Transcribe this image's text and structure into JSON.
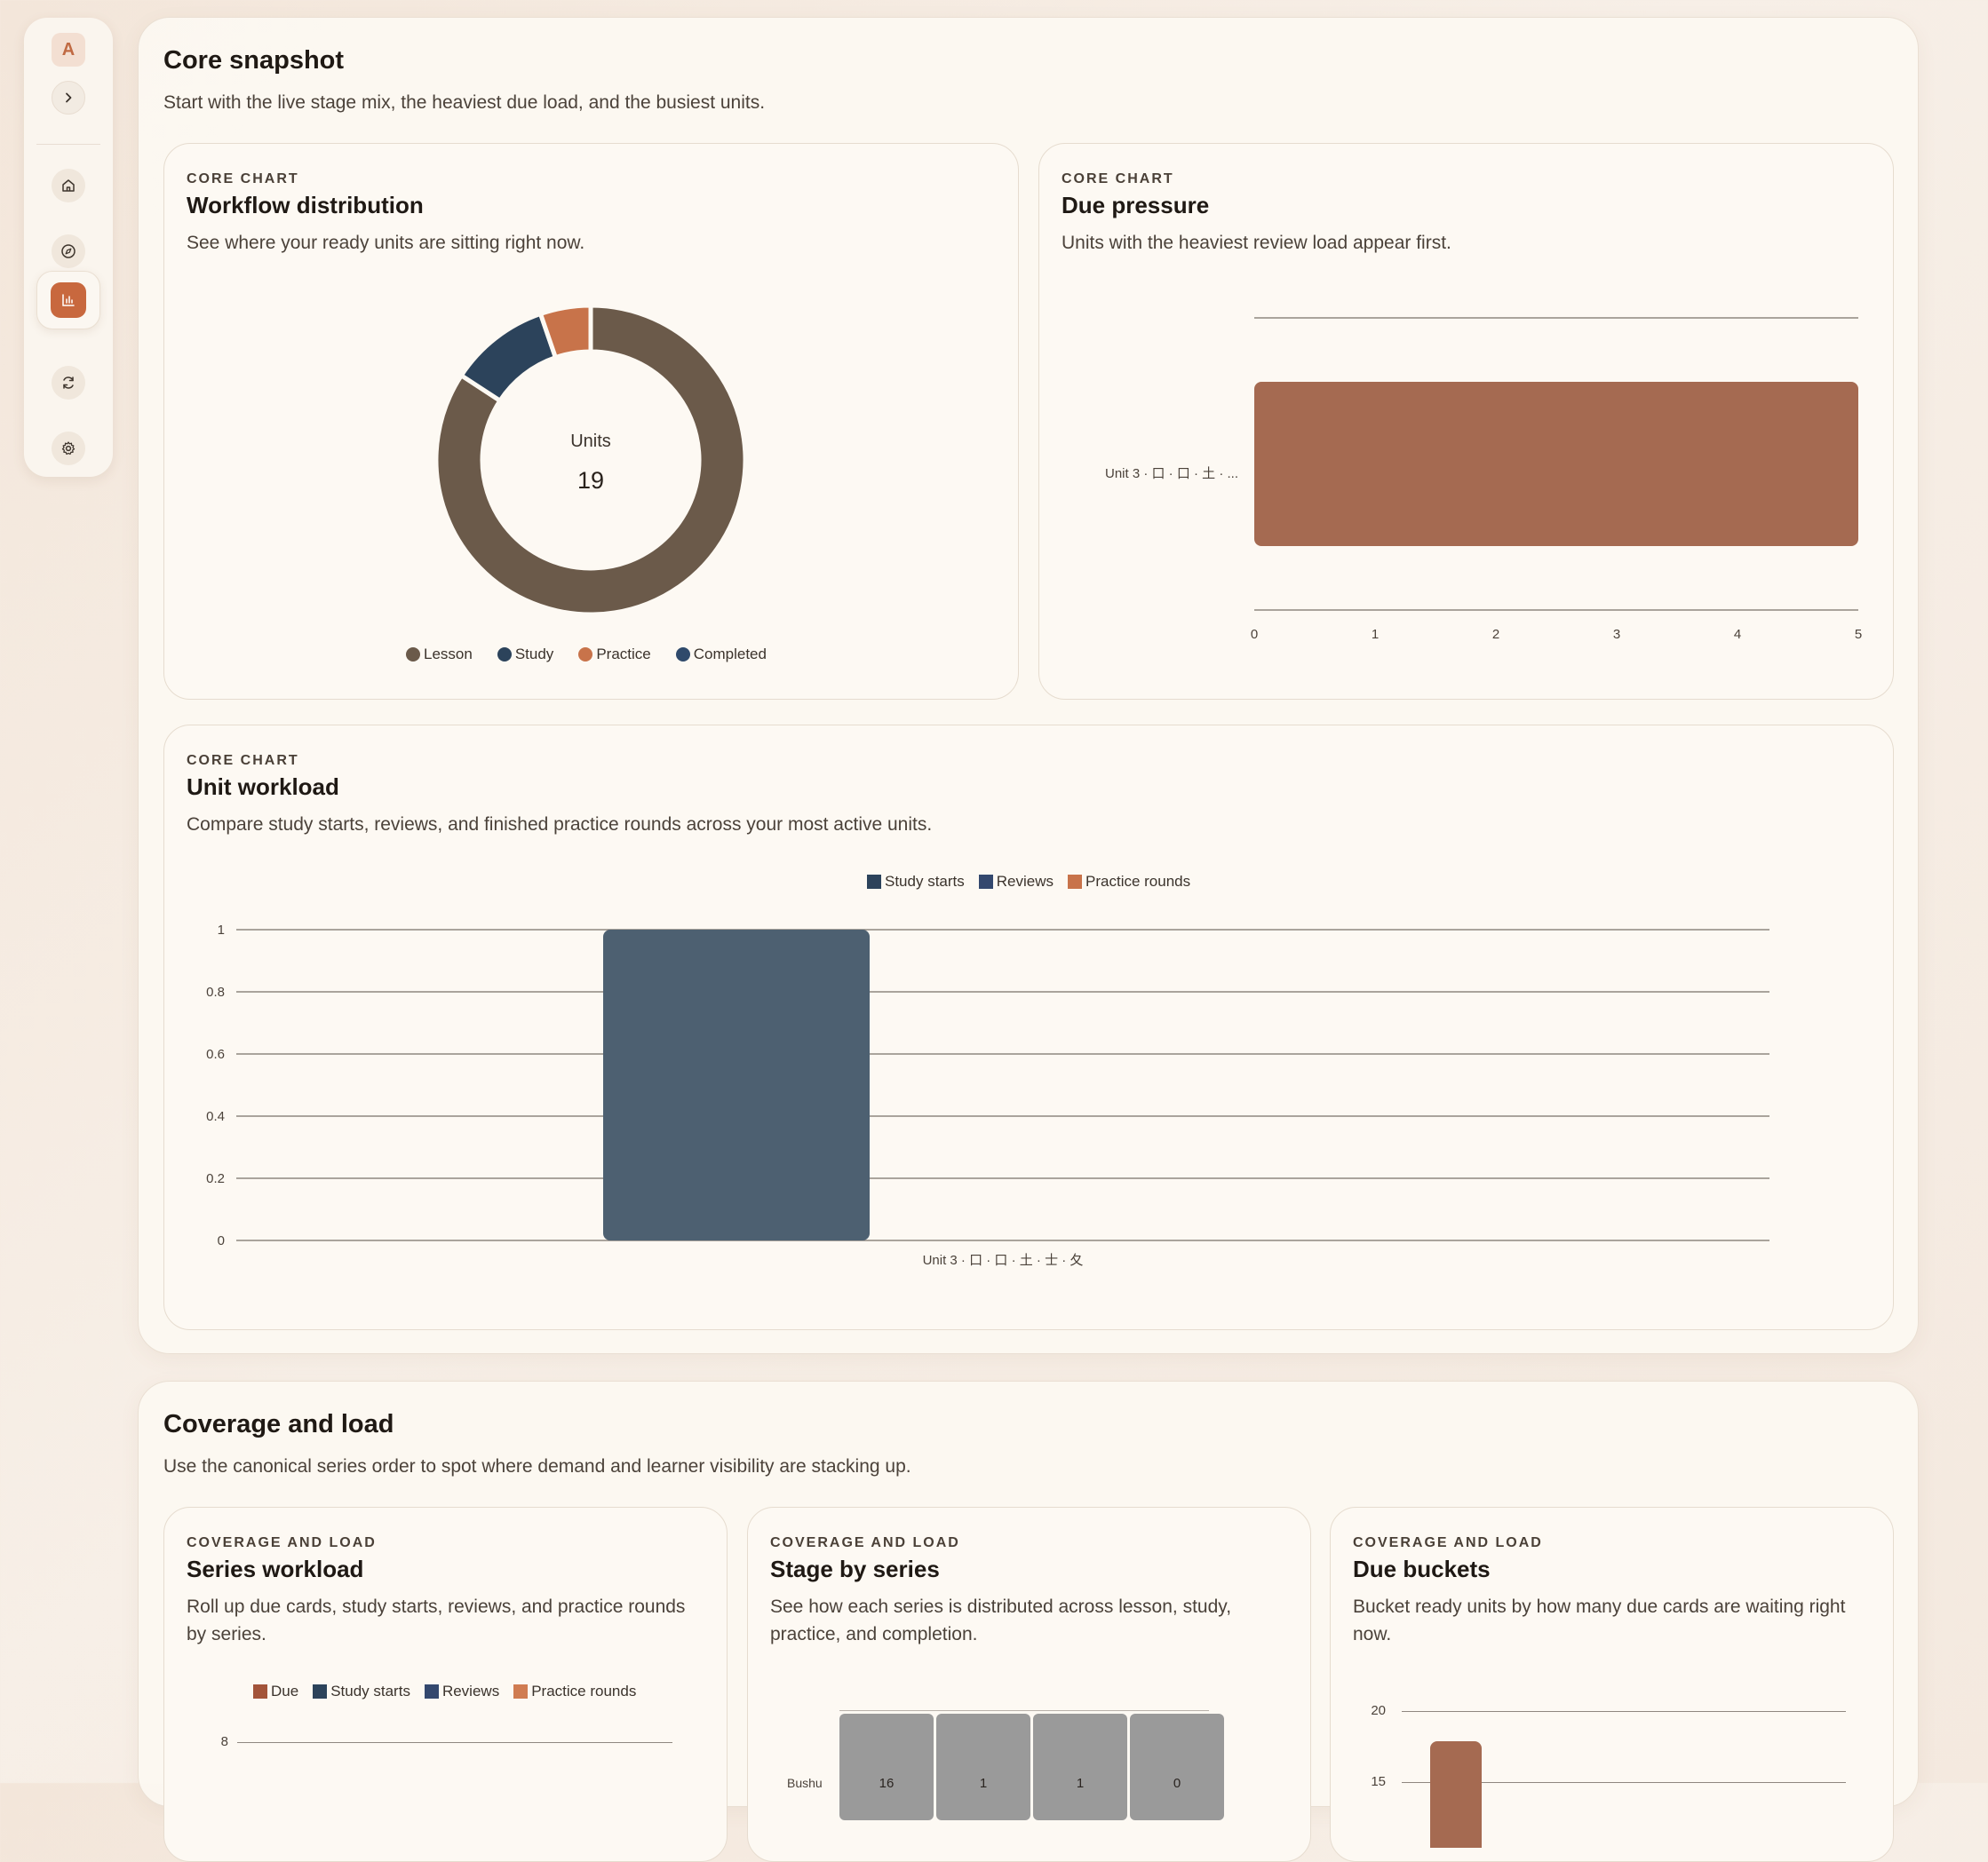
{
  "sidebar": {
    "avatar_letter": "A",
    "items": [
      {
        "icon": "home-icon"
      },
      {
        "icon": "compass-icon"
      },
      {
        "icon": "chart-icon",
        "active": true
      },
      {
        "icon": "refresh-icon"
      },
      {
        "icon": "gear-icon"
      }
    ]
  },
  "colors": {
    "accent": "#c8683e",
    "lesson": "#6b5a4a",
    "study": "#2c435b",
    "practice": "#c8734a",
    "completed": "#2f4a6b",
    "due_bar": "#a56a51",
    "workload_bar": "#4d6071"
  },
  "core": {
    "title": "Core snapshot",
    "subtitle": "Start with the live stage mix, the heaviest due load, and the busiest units.",
    "workflow": {
      "eyebrow": "CORE CHART",
      "title": "Workflow distribution",
      "subtitle": "See where your ready units are sitting right now.",
      "center_label": "Units",
      "center_value": "19",
      "legend": [
        "Lesson",
        "Study",
        "Practice",
        "Completed"
      ]
    },
    "due": {
      "eyebrow": "CORE CHART",
      "title": "Due pressure",
      "subtitle": "Units with the heaviest review load appear first.",
      "bar_label": "Unit 3 · 口 · 口 · 土 · ...",
      "ticks": [
        "0",
        "1",
        "2",
        "3",
        "4",
        "5"
      ]
    },
    "workload": {
      "eyebrow": "CORE CHART",
      "title": "Unit workload",
      "subtitle": "Compare study starts, reviews, and finished practice rounds across your most active units.",
      "legend": [
        "Study starts",
        "Reviews",
        "Practice rounds"
      ],
      "yticks": [
        "1",
        "0.8",
        "0.6",
        "0.4",
        "0.2",
        "0"
      ],
      "category": "Unit 3 · 口 · 口 · 土 · 士 · 夂"
    }
  },
  "coverage": {
    "title": "Coverage and load",
    "subtitle": "Use the canonical series order to spot where demand and learner visibility are stacking up.",
    "series_workload": {
      "eyebrow": "COVERAGE AND LOAD",
      "title": "Series workload",
      "subtitle": "Roll up due cards, study starts, reviews, and practice rounds by series.",
      "legend": [
        "Due",
        "Study starts",
        "Reviews",
        "Practice rounds"
      ],
      "ytick_top": "8"
    },
    "stage_by_series": {
      "eyebrow": "COVERAGE AND LOAD",
      "title": "Stage by series",
      "subtitle": "See how each series is distributed across lesson, study, practice, and completion.",
      "row_label": "Bushu",
      "values": [
        "16",
        "1",
        "1",
        "0"
      ]
    },
    "due_buckets": {
      "eyebrow": "COVERAGE AND LOAD",
      "title": "Due buckets",
      "subtitle": "Bucket ready units by how many due cards are waiting right now.",
      "yticks": [
        "20",
        "15"
      ]
    }
  },
  "chart_data": [
    {
      "type": "pie",
      "title": "Workflow distribution",
      "categories": [
        "Lesson",
        "Study",
        "Practice",
        "Completed"
      ],
      "values": [
        16,
        2,
        1,
        0
      ],
      "total": 19
    },
    {
      "type": "bar",
      "title": "Due pressure",
      "orientation": "horizontal",
      "categories": [
        "Unit 3 · 口 · 口 · 土 · ..."
      ],
      "values": [
        5
      ],
      "xlim": [
        0,
        5
      ]
    },
    {
      "type": "bar",
      "title": "Unit workload",
      "categories": [
        "Unit 3 · 口 · 口 · 土 · 士 · 夂"
      ],
      "series": [
        {
          "name": "Study starts",
          "values": [
            1
          ]
        },
        {
          "name": "Reviews",
          "values": [
            0
          ]
        },
        {
          "name": "Practice rounds",
          "values": [
            0
          ]
        }
      ],
      "ylim": [
        0,
        1
      ]
    }
  ]
}
